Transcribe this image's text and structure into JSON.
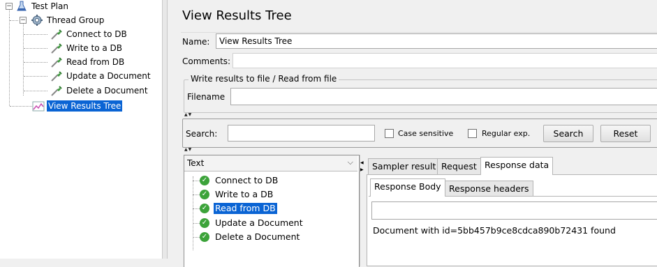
{
  "tree": {
    "test_plan": "Test Plan",
    "thread_group": "Thread Group",
    "samplers": [
      "Connect to DB",
      "Write to a DB",
      "Read from DB",
      "Update a Document",
      "Delete a Document"
    ],
    "listener": "View Results Tree"
  },
  "panel": {
    "title": "View Results Tree",
    "name_label": "Name:",
    "name_value": "View Results Tree",
    "comments_label": "Comments:",
    "comments_value": "",
    "file_section": "Write results to file / Read from file",
    "filename_label": "Filename",
    "filename_value": ""
  },
  "search": {
    "label": "Search:",
    "value": "",
    "case_sensitive": "Case sensitive",
    "regular_exp": "Regular exp.",
    "search_button": "Search",
    "reset_button": "Reset"
  },
  "results": {
    "renderer": "Text",
    "items": [
      "Connect to DB",
      "Write to a DB",
      "Read from DB",
      "Update a Document",
      "Delete a Document"
    ],
    "selected_index": 2
  },
  "tabs": {
    "main": [
      "Sampler result",
      "Request",
      "Response data"
    ],
    "active_main": "Response data",
    "sub": [
      "Response Body",
      "Response headers"
    ],
    "active_sub": "Response Body"
  },
  "response": {
    "body": "Document with id=5bb457b9ce8cdca890b72431 found"
  },
  "colors": {
    "selection": "#0a64d4",
    "success": "#3ca33a"
  }
}
